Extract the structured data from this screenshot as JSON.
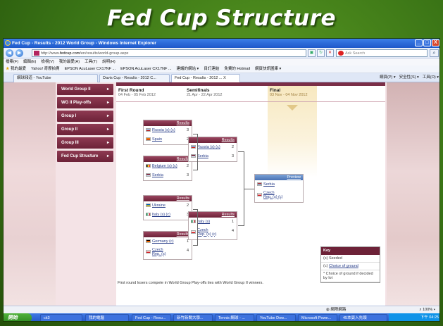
{
  "slide": {
    "title": "Fed Cup Structure"
  },
  "window": {
    "title": "Fed Cup - Results - 2012 World Group - Windows Internet Explorer",
    "min": "_",
    "max": "□",
    "close": "X"
  },
  "address": {
    "url_prefix": "http://www.",
    "url_domain": "fedcup.com",
    "url_path": "/en/results/world-group.aspx",
    "search_placeholder": "Ask Search",
    "back": "◀",
    "fwd": "▶"
  },
  "menu": [
    "檔案(F)",
    "編輯(E)",
    "檢視(V)",
    "我的最愛(A)",
    "工具(T)",
    "說明(H)"
  ],
  "favorites": [
    "我的最愛",
    "Yahoo! 奇摩拍賣",
    "EPSON AcuLaser CX17NF ...",
    "EPSON AcuLaser CX17NF ...",
    "建議的網站 ▾",
    "目訂連結",
    "免費的 Hotmail",
    "網頁快訊圖庫 ▾"
  ],
  "tabs": [
    "網球頻道 - YouTube",
    "Davis Cup - Results - 2012 C...",
    "Fed Cup - Results - 2012 ..."
  ],
  "tab_close": "X",
  "commands": [
    "網頁(P) ▾",
    "安全性(S) ▾",
    "工具(O) ▾"
  ],
  "sidebar": [
    "World Group II",
    "WG II Play-offs",
    "Group I",
    "Group II",
    "Group III",
    "Fed Cup Structure"
  ],
  "rounds": [
    {
      "name": "First Round",
      "dates": "04 Feb - 05 Feb 2012"
    },
    {
      "name": "Semifinals",
      "dates": "21 Apr - 22 Apr 2012"
    },
    {
      "name": "Final",
      "dates": "03 Nov - 04 Nov 2012"
    }
  ],
  "results_label": "Results",
  "preview_label": "Preview",
  "matches": {
    "r1": [
      {
        "t1": "Russia (s) (c)",
        "s1": "3",
        "t2": "Spain",
        "s2": "2"
      },
      {
        "t1": "Belgium (s) (c)",
        "s1": "2",
        "t2": "Serbia",
        "s2": "3"
      },
      {
        "t1": "Ukraine",
        "s1": "2",
        "t2": "Italy (s) (c)",
        "s2": "3"
      },
      {
        "t1": "Germany (c)",
        "s1": "1",
        "t2a": "Czech",
        "t2b": "Rep. (s)",
        "s2": "4"
      }
    ],
    "sf": [
      {
        "t1": "Russia (s) (c)",
        "s1": "2",
        "t2": "Serbia",
        "s2": "3"
      },
      {
        "t1": "Italy (s)",
        "s1": "1",
        "t2a": "Czech",
        "t2b": "Rep. (s) (c)",
        "s2": "4"
      }
    ],
    "final": {
      "t1": "Serbia",
      "t2a": "Czech",
      "t2b": "Rep. (s) (c)"
    }
  },
  "note": "First round losers compete in World Group Play-offs ties with World Group II winners.",
  "key": {
    "title": "Key",
    "seeded": "(s) Seeded",
    "choice_prefix": "(c) ",
    "choice": "Choice of ground",
    "lot": "* Choice of ground if decided by lot"
  },
  "status": {
    "zone": "網際網路",
    "zoom": "100%"
  },
  "taskbar": {
    "start": "開始",
    "items": [
      "ck3",
      "我的電腦",
      "Fed Cup - Resu...",
      "新竹新聞大學...",
      "Tennis 網球 - ...",
      "YouTube Dow...",
      "Microsoft Powe...",
      "45本頁入先頭"
    ],
    "clock": "下午 04:25"
  },
  "colors": {
    "maroon": "#6d2238",
    "slide_green": "#3a7416",
    "ie_blue": "#1e58c9"
  }
}
